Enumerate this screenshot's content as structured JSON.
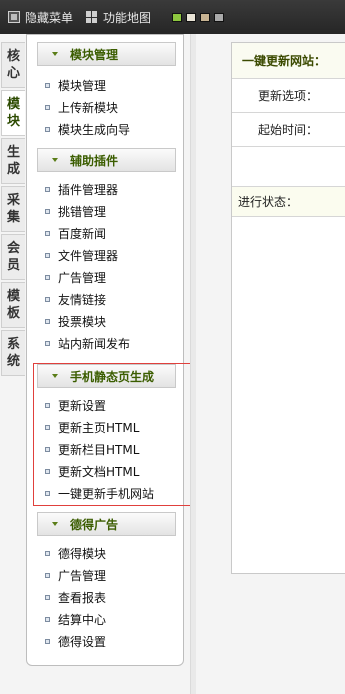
{
  "toolbar": {
    "hide_menu_label": "隐藏菜单",
    "sitemap_label": "功能地图",
    "theme_swatches": [
      "#8dc63f",
      "#e9e4d6",
      "#c7b392",
      "#a9a9a9"
    ]
  },
  "vertical_tabs": [
    {
      "label": "核心",
      "active": false
    },
    {
      "label": "模块",
      "active": true
    },
    {
      "label": "生成",
      "active": false
    },
    {
      "label": "采集",
      "active": false
    },
    {
      "label": "会员",
      "active": false
    },
    {
      "label": "模板",
      "active": false
    },
    {
      "label": "系统",
      "active": false
    }
  ],
  "menu": {
    "groups": [
      {
        "title": "模块管理",
        "items": [
          "模块管理",
          "上传新模块",
          "模块生成向导"
        ]
      },
      {
        "title": "辅助插件",
        "items": [
          "插件管理器",
          "挑错管理",
          "百度新闻",
          "文件管理器",
          "广告管理",
          "友情链接",
          "投票模块",
          "站内新闻发布"
        ]
      },
      {
        "title": "手机静态页生成",
        "items": [
          "更新设置",
          "更新主页HTML",
          "更新栏目HTML",
          "更新文档HTML",
          "一键更新手机网站"
        ]
      },
      {
        "title": "德得广告",
        "items": [
          "德得模块",
          "广告管理",
          "查看报表",
          "结算中心",
          "德得设置"
        ]
      }
    ]
  },
  "content": {
    "header": "一键更新网站：",
    "update_options_label": "更新选项：",
    "start_time_label": "起始时间：",
    "status_label": "进行状态："
  }
}
